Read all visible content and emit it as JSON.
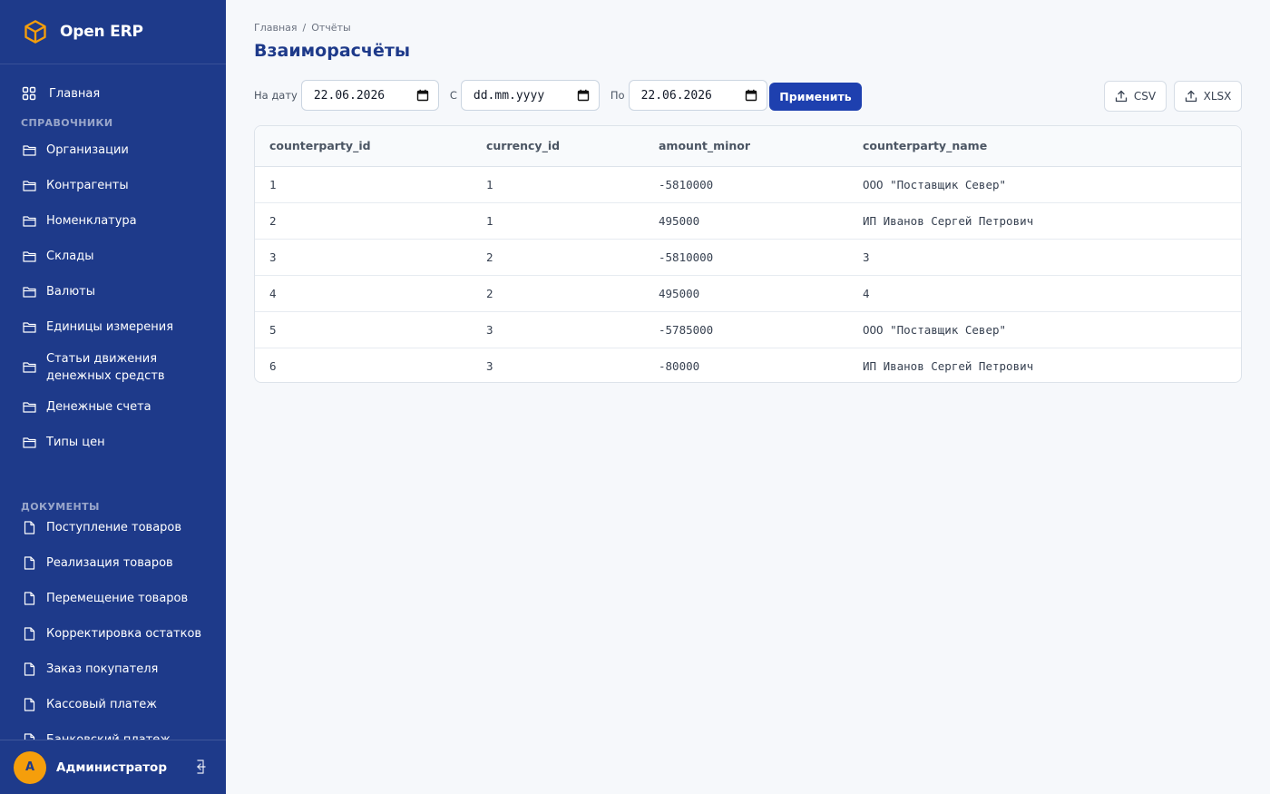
{
  "app": {
    "name": "Open ERP"
  },
  "sidebar": {
    "home": {
      "label": "Главная"
    },
    "sections": [
      {
        "title": "СПРАВОЧНИКИ",
        "items": [
          {
            "label": "Организации",
            "icon": "folder-icon"
          },
          {
            "label": "Контрагенты",
            "icon": "folder-icon"
          },
          {
            "label": "Номенклатура",
            "icon": "folder-icon"
          },
          {
            "label": "Склады",
            "icon": "folder-icon"
          },
          {
            "label": "Валюты",
            "icon": "folder-icon"
          },
          {
            "label": "Единицы измерения",
            "icon": "folder-icon"
          },
          {
            "label_line1": "Статьи движения",
            "label_line2": "денежных средств",
            "icon": "folder-icon"
          },
          {
            "label": "Денежные счета",
            "icon": "folder-icon"
          },
          {
            "label": "Типы цен",
            "icon": "folder-icon"
          }
        ]
      },
      {
        "title": "ДОКУМЕНТЫ",
        "items": [
          {
            "label": "Поступление товаров",
            "icon": "document-icon"
          },
          {
            "label": "Реализация товаров",
            "icon": "document-icon"
          },
          {
            "label": "Перемещение товаров",
            "icon": "document-icon"
          },
          {
            "label": "Корректировка остатков",
            "icon": "document-icon"
          },
          {
            "label": "Заказ покупателя",
            "icon": "document-icon"
          },
          {
            "label": "Кассовый платеж",
            "icon": "document-icon"
          },
          {
            "label": "Банковский платеж",
            "icon": "document-icon"
          }
        ]
      }
    ]
  },
  "user": {
    "initial": "А",
    "name": "Администратор"
  },
  "breadcrumb": {
    "home": "Главная",
    "separator": "/",
    "current": "Отчёты"
  },
  "page": {
    "title": "Взаиморасчёты"
  },
  "filters": {
    "on_date_label": "На дату",
    "on_date_value": "22.06.2026",
    "from_label": "С",
    "from_value": "dd.mm.yyyy",
    "to_label": "По",
    "to_value": "22.06.2026",
    "apply_label": "Применить"
  },
  "export": {
    "csv_label": "CSV",
    "xlsx_label": "XLSX"
  },
  "table": {
    "columns": [
      "counterparty_id",
      "currency_id",
      "amount_minor",
      "counterparty_name"
    ],
    "rows": [
      [
        "1",
        "1",
        "-5810000",
        "ООО \"Поставщик Север\""
      ],
      [
        "2",
        "1",
        "495000",
        "ИП Иванов Сергей Петрович"
      ],
      [
        "3",
        "2",
        "-5810000",
        "3"
      ],
      [
        "4",
        "2",
        "495000",
        "4"
      ],
      [
        "5",
        "3",
        "-5785000",
        "ООО \"Поставщик Север\""
      ],
      [
        "6",
        "3",
        "-80000",
        "ИП Иванов Сергей Петрович"
      ]
    ]
  },
  "colors": {
    "sidebar_bg": "#1e3a8a",
    "accent": "#1e40af",
    "logo": "#f59e0b"
  }
}
